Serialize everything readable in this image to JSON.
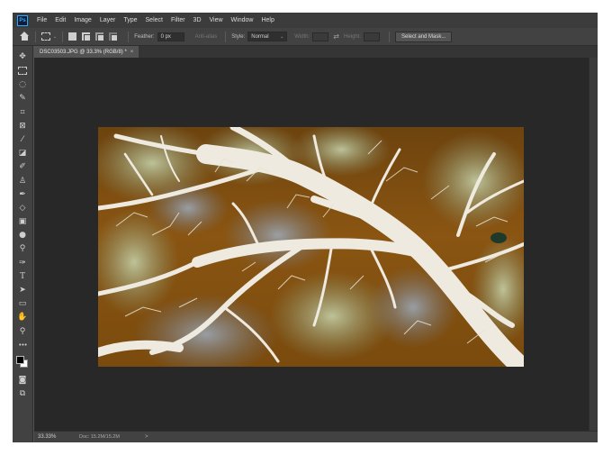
{
  "menu": {
    "items": [
      "File",
      "Edit",
      "Image",
      "Layer",
      "Type",
      "Select",
      "Filter",
      "3D",
      "View",
      "Window",
      "Help"
    ]
  },
  "logo": {
    "text": "Ps"
  },
  "options": {
    "feather_label": "Feather:",
    "feather_value": "0 px",
    "antialias_label": "Anti-alias",
    "style_label": "Style:",
    "style_value": "Normal",
    "width_label": "Width:",
    "height_label": "Height:",
    "select_mask_label": "Select and Mask..."
  },
  "tools": [
    {
      "name": "move-tool",
      "icon": "move-icon"
    },
    {
      "name": "marquee-tool",
      "icon": "marquee-icon"
    },
    {
      "name": "lasso-tool",
      "icon": "lasso-icon"
    },
    {
      "name": "quick-selection-tool",
      "icon": "quick-selection-icon"
    },
    {
      "name": "crop-tool",
      "icon": "crop-icon"
    },
    {
      "name": "frame-tool",
      "icon": "frame-icon"
    },
    {
      "name": "eyedropper-tool",
      "icon": "eyedropper-icon"
    },
    {
      "name": "healing-brush-tool",
      "icon": "bandage-icon"
    },
    {
      "name": "brush-tool",
      "icon": "brush-icon"
    },
    {
      "name": "clone-stamp-tool",
      "icon": "stamp-icon"
    },
    {
      "name": "history-brush-tool",
      "icon": "history-brush-icon"
    },
    {
      "name": "eraser-tool",
      "icon": "eraser-icon"
    },
    {
      "name": "gradient-tool",
      "icon": "gradient-icon"
    },
    {
      "name": "blur-tool",
      "icon": "droplet-icon"
    },
    {
      "name": "dodge-tool",
      "icon": "dodge-icon"
    },
    {
      "name": "pen-tool",
      "icon": "pen-icon"
    },
    {
      "name": "type-tool",
      "icon": "type-icon"
    },
    {
      "name": "path-selection-tool",
      "icon": "arrow-icon"
    },
    {
      "name": "rectangle-tool",
      "icon": "rectangle-icon"
    },
    {
      "name": "hand-tool",
      "icon": "hand-icon"
    },
    {
      "name": "zoom-tool",
      "icon": "zoom-icon"
    },
    {
      "name": "more-tools",
      "icon": "ellipsis-icon"
    }
  ],
  "colors": {
    "foreground": "#000000",
    "background": "#ffffff",
    "accent": "#31a8ff"
  },
  "document": {
    "tab_title": "DSC03503.JPG @ 33.3% (RGB/8) *",
    "close_glyph": "×"
  },
  "status": {
    "zoom": "33.33%",
    "doc_info": "Doc: 15.2M/15.2M",
    "arrow": ">"
  }
}
